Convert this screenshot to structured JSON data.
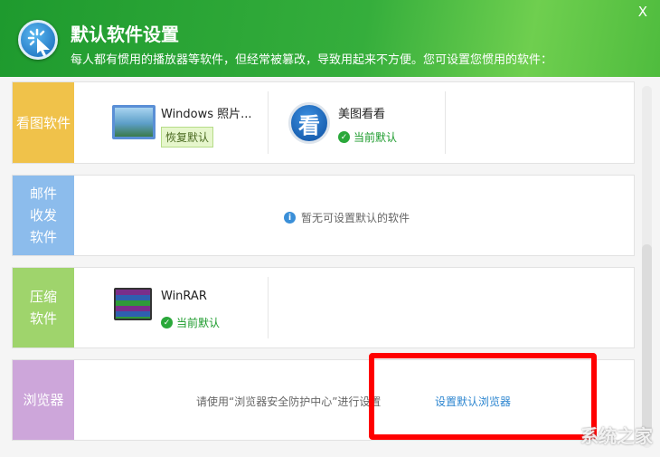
{
  "header": {
    "title": "默认软件设置",
    "subtitle": "每人都有惯用的播放器等软件，但经常被篡改，导致用起来不方便。您可设置您惯用的软件：",
    "close": "X"
  },
  "colors": {
    "image": "#f0c24a",
    "mail": "#8cbcec",
    "archive": "#9fd46c",
    "browser": "#cda6da"
  },
  "rows": [
    {
      "category": "看图软件",
      "apps": [
        {
          "name": "Windows 照片...",
          "action": "恢复默认"
        },
        {
          "name": "美图看看",
          "status": "当前默认",
          "icon_text": "看"
        }
      ]
    },
    {
      "category": "邮件收发软件",
      "message": "暂无可设置默认的软件"
    },
    {
      "category": "压缩软件",
      "apps": [
        {
          "name": "WinRAR",
          "status": "当前默认"
        }
      ]
    },
    {
      "category": "浏览器",
      "message": "请使用“浏览器安全防护中心”进行设置",
      "link": "设置默认浏览器"
    }
  ],
  "watermark": "系统之家"
}
